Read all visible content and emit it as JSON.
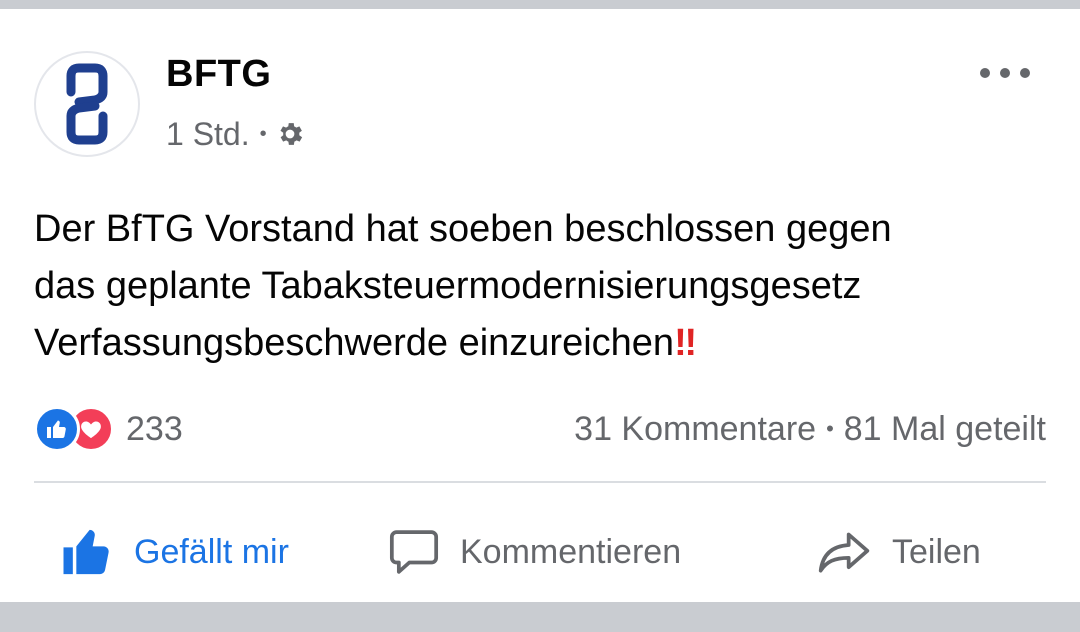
{
  "post": {
    "page_name": "BFTG",
    "time": "1 Std.",
    "separator": "•",
    "privacy_icon": "gear-icon",
    "more_icon": "more-options-icon",
    "text_lines": [
      "Der BfTG Vorstand hat soeben beschlossen gegen",
      "das geplante Tabaksteuermodernisierungsgesetz",
      "Verfassungsbeschwerde einzureichen"
    ],
    "emoji": "‼"
  },
  "reactions": {
    "icons": [
      "like-reaction-icon",
      "love-reaction-icon"
    ],
    "count": "233"
  },
  "stats": {
    "comments": "31 Kommentare",
    "separator": "•",
    "shares": "81 Mal geteilt"
  },
  "actions": {
    "like_label": "Gefällt mir",
    "comment_label": "Kommentieren",
    "share_label": "Teilen"
  },
  "colors": {
    "accent": "#1b74e4",
    "love": "#f33e58",
    "muted": "#65676b",
    "background": "#c9ccd1"
  }
}
